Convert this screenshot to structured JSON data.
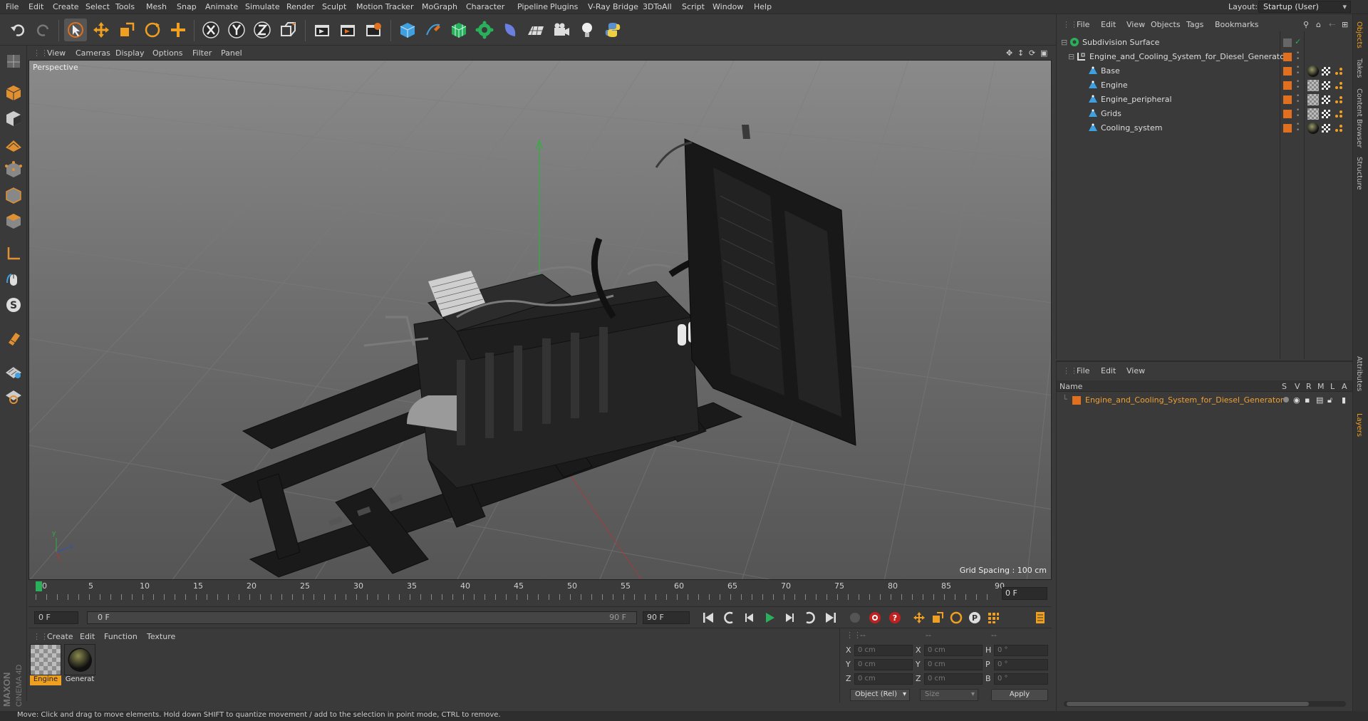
{
  "menubar": {
    "items": [
      "File",
      "Edit",
      "Create",
      "Select",
      "Tools",
      "Mesh",
      "Snap",
      "Animate",
      "Simulate",
      "Render",
      "Sculpt",
      "Motion Tracker",
      "MoGraph",
      "Character",
      "Pipeline",
      "Plugins",
      "V-Ray Bridge",
      "3DToAll",
      "Script",
      "Window",
      "Help"
    ],
    "layout_label": "Layout:",
    "layout_value": "Startup (User)"
  },
  "toolbar": {
    "icons": [
      "undo-icon",
      "redo-icon",
      "select-arrow-icon",
      "move-icon",
      "scale-icon",
      "rotate-icon",
      "add-object-icon",
      "x-axis-icon",
      "y-axis-icon",
      "z-axis-icon",
      "coord-system-icon",
      "render-view-icon",
      "render-picture-viewer-icon",
      "edit-render-settings-icon",
      "cube-primitive-icon",
      "pen-spline-icon",
      "subdivision-icon",
      "mograph-cloner-icon",
      "deformer-icon",
      "floor-icon",
      "camera-icon",
      "light-icon",
      "python-icon"
    ]
  },
  "viewport": {
    "menu": [
      "View",
      "Cameras",
      "Display",
      "Options",
      "Filter",
      "Panel"
    ],
    "label": "Perspective",
    "grid_spacing": "Grid Spacing : 100 cm"
  },
  "timeline": {
    "ticks": [
      "0",
      "5",
      "10",
      "15",
      "20",
      "25",
      "30",
      "35",
      "40",
      "45",
      "50",
      "55",
      "60",
      "65",
      "70",
      "75",
      "80",
      "85",
      "90"
    ],
    "current_frame": "0 F"
  },
  "transport": {
    "start_field": "0 F",
    "range_start": "0 F",
    "range_end": "90 F",
    "end_field": "90 F"
  },
  "material_panel": {
    "menu": [
      "Create",
      "Edit",
      "Function",
      "Texture"
    ],
    "materials": [
      {
        "name": "Engine",
        "selected": true
      },
      {
        "name": "Generat",
        "selected": false
      }
    ]
  },
  "coordinates": {
    "header": [
      "--",
      "--",
      "--"
    ],
    "rows": [
      {
        "axis": "X",
        "pos": "0 cm",
        "size_axis": "X",
        "size": "0 cm",
        "rot_axis": "H",
        "rot": "0 °"
      },
      {
        "axis": "Y",
        "pos": "0 cm",
        "size_axis": "Y",
        "size": "0 cm",
        "rot_axis": "P",
        "rot": "0 °"
      },
      {
        "axis": "Z",
        "pos": "0 cm",
        "size_axis": "Z",
        "size": "0 cm",
        "rot_axis": "B",
        "rot": "0 °"
      }
    ],
    "mode": "Object (Rel)",
    "size_mode": "Size",
    "apply": "Apply"
  },
  "object_manager": {
    "menu": [
      "File",
      "Edit",
      "View",
      "Objects",
      "Tags",
      "Bookmarks"
    ],
    "objects": [
      {
        "name": "Subdivision Surface",
        "indent": 0
      },
      {
        "name": "Engine_and_Cooling_System_for_Diesel_Generator",
        "indent": 1
      },
      {
        "name": "Base",
        "indent": 2
      },
      {
        "name": "Engine",
        "indent": 2
      },
      {
        "name": "Engine_peripheral",
        "indent": 2
      },
      {
        "name": "Grids",
        "indent": 2
      },
      {
        "name": "Cooling_system",
        "indent": 2
      }
    ]
  },
  "layer_manager": {
    "menu": [
      "File",
      "Edit",
      "View"
    ],
    "columns": [
      "Name",
      "S",
      "V",
      "R",
      "M",
      "L",
      "A"
    ],
    "layers": [
      {
        "name": "Engine_and_Cooling_System_for_Diesel_Generator"
      }
    ]
  },
  "right_tabs": [
    "Objects",
    "Takes",
    "Content Browser",
    "Structure",
    "Attributes",
    "Layers"
  ],
  "brand": {
    "maxon": "MAXON",
    "cinema": "CINEMA 4D"
  },
  "status": "Move: Click and drag to move elements. Hold down SHIFT to quantize movement / add to the selection in point mode, CTRL to remove.",
  "colors": {
    "accent": "#e07020",
    "selected_text": "#f0a030",
    "bg": "#3a3a3a"
  }
}
